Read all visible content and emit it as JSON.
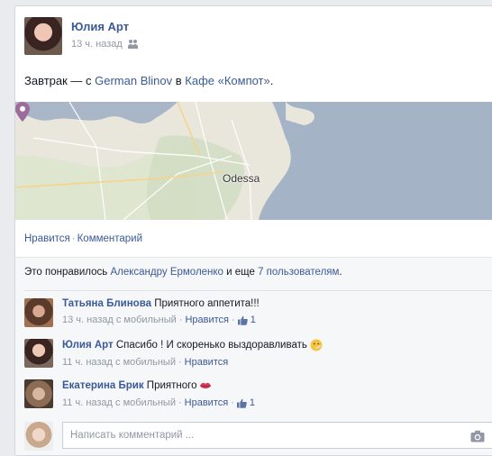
{
  "post": {
    "author": "Юлия Арт",
    "time": "13 ч. назад",
    "audience_icon": "friends-icon",
    "text_prefix": "Завтрак — с ",
    "with_person": "German Blinov",
    "text_mid": " в ",
    "place": "Кафе «Компот»",
    "text_suffix": ".",
    "map_label": "Odessa"
  },
  "actions": {
    "like": "Нравится",
    "separator": "·",
    "comment": "Комментарий"
  },
  "likes": {
    "prefix": "Это понравилось ",
    "name": "Александру Ермоленко",
    "middle": " и еще ",
    "others": "7 пользователям",
    "suffix": "."
  },
  "comments": [
    {
      "name": "Татьяна Блинова",
      "text": " Приятного аппетита!!!",
      "time": "13 ч. назад с мобильный",
      "like_label": "Нравится",
      "likes_count": "1",
      "dot": "·"
    },
    {
      "name": "Юлия Арт",
      "text": " Спасибо ! И скоренько выздоравливать",
      "time": "11 ч. назад с мобильный",
      "like_label": "Нравится",
      "dot": "·",
      "emoji": "thermometer-face-emoji"
    },
    {
      "name": "Екатерина Брик",
      "text": " Приятного",
      "time": "11 ч. назад с мобильный",
      "like_label": "Нравится",
      "likes_count": "1",
      "dot": "·",
      "emoji": "kiss-lips-emoji"
    }
  ],
  "composer": {
    "placeholder": "Написать комментарий ...",
    "camera_icon": "camera-icon"
  }
}
